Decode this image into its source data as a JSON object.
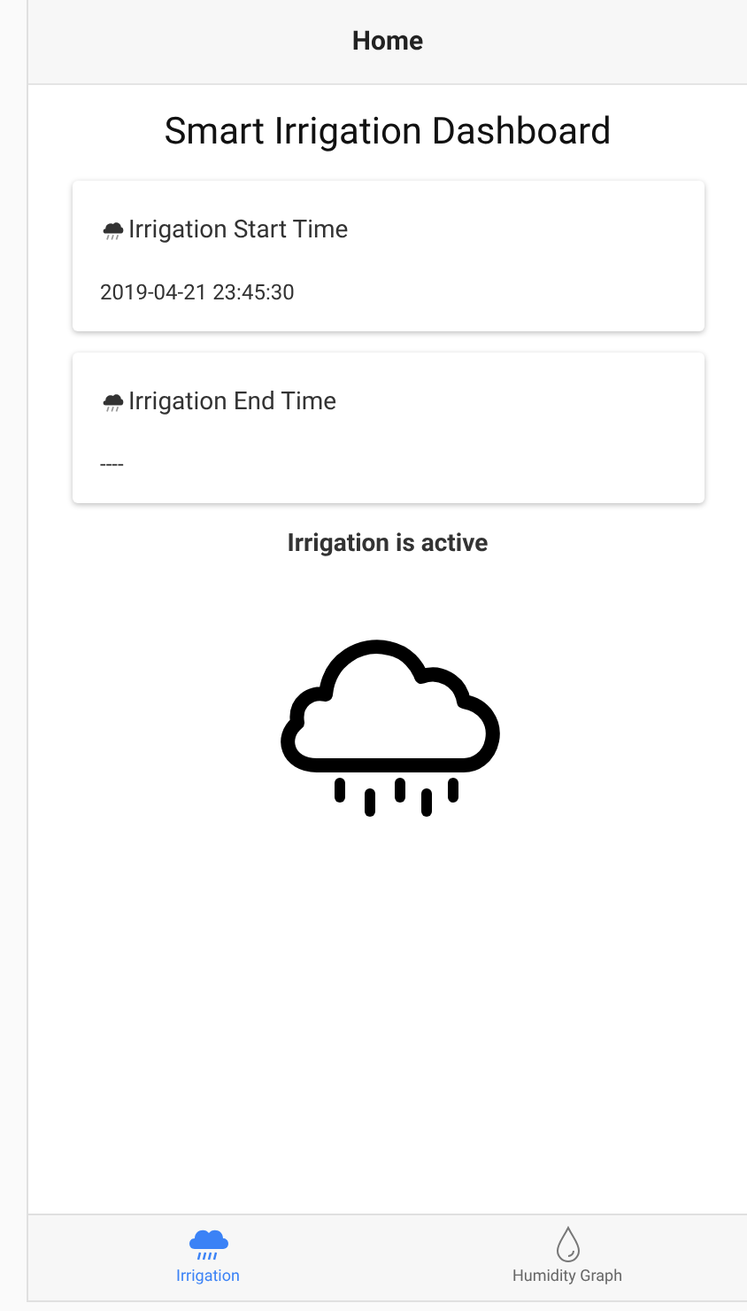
{
  "header": {
    "title": "Home"
  },
  "page_title": "Smart Irrigation Dashboard",
  "cards": [
    {
      "title": "Irrigation Start Time",
      "value": "2019-04-21 23:45:30"
    },
    {
      "title": "Irrigation End Time",
      "value": "----"
    }
  ],
  "status": "Irrigation is active",
  "tabs": [
    {
      "label": "Irrigation",
      "kind": "rain",
      "selected": true
    },
    {
      "label": "Humidity Graph",
      "kind": "drop",
      "selected": false
    }
  ]
}
